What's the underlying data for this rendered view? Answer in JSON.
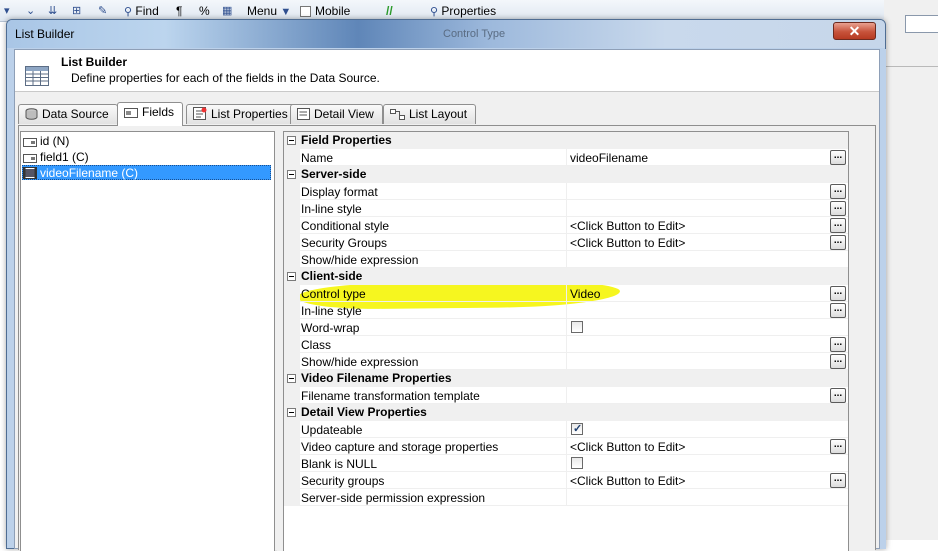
{
  "toolbar": {
    "find_label": "Find",
    "menu_label": "Menu",
    "mobile_label": "Mobile",
    "properties_label": "Properties",
    "pilcrow": "¶",
    "percent": "%"
  },
  "dialog": {
    "title": "List Builder",
    "ghost_title": "Control Type",
    "close_glyph": "✕"
  },
  "header": {
    "title": "List Builder",
    "description": "Define properties for each of the fields in the Data Source."
  },
  "tabs": [
    {
      "label": "Data Source",
      "icon": "database-icon"
    },
    {
      "label": "Fields",
      "icon": "fields-icon",
      "active": true
    },
    {
      "label": "List Properties",
      "icon": "list-properties-icon"
    },
    {
      "label": "Detail View",
      "icon": "detail-view-icon"
    },
    {
      "label": "List Layout",
      "icon": "list-layout-icon"
    }
  ],
  "fields": [
    {
      "label": "id (N)",
      "icon": "numeric-field-icon"
    },
    {
      "label": "field1 (C)",
      "icon": "character-field-icon"
    },
    {
      "label": "videoFilename (C)",
      "icon": "video-field-icon",
      "selected": true
    }
  ],
  "grid": {
    "ellipsis": "...",
    "rows": [
      {
        "type": "category",
        "label": "Field Properties"
      },
      {
        "type": "prop",
        "name": "Name",
        "value": "videoFilename",
        "button": true
      },
      {
        "type": "category",
        "label": "Server-side"
      },
      {
        "type": "prop",
        "name": "Display format",
        "value": "",
        "button": true
      },
      {
        "type": "prop",
        "name": "In-line style",
        "value": "",
        "button": true
      },
      {
        "type": "prop",
        "name": "Conditional style",
        "value": "<Click Button to Edit>",
        "button": true
      },
      {
        "type": "prop",
        "name": "Security Groups",
        "value": "<Click Button to Edit>",
        "button": true
      },
      {
        "type": "prop",
        "name": "Show/hide expression",
        "value": "",
        "button": false
      },
      {
        "type": "category",
        "label": "Client-side"
      },
      {
        "type": "prop",
        "name": "Control type",
        "value": "Video",
        "button": true
      },
      {
        "type": "prop",
        "name": "In-line style",
        "value": "",
        "button": true
      },
      {
        "type": "prop",
        "name": "Word-wrap",
        "checkbox": true,
        "checked": false,
        "button": false
      },
      {
        "type": "prop",
        "name": "Class",
        "value": "",
        "button": true
      },
      {
        "type": "prop",
        "name": "Show/hide expression",
        "value": "",
        "button": true
      },
      {
        "type": "category",
        "label": "Video Filename Properties"
      },
      {
        "type": "prop",
        "name": "Filename transformation template",
        "value": "",
        "button": true
      },
      {
        "type": "category",
        "label": "Detail View Properties"
      },
      {
        "type": "prop",
        "name": "Updateable",
        "checkbox": true,
        "checked": true,
        "button": false
      },
      {
        "type": "prop",
        "name": "Video capture and storage properties",
        "value": "<Click Button to Edit>",
        "button": true
      },
      {
        "type": "prop",
        "name": "Blank is NULL",
        "checkbox": true,
        "checked": false,
        "button": false
      },
      {
        "type": "prop",
        "name": "Security groups",
        "value": "<Click Button to Edit>",
        "button": true
      },
      {
        "type": "prop",
        "name": "Server-side permission expression",
        "value": "",
        "button": false
      }
    ]
  },
  "colors": {
    "highlight": "#f5f500",
    "selection": "#3399ff",
    "title_bar": "#5f86b8"
  }
}
